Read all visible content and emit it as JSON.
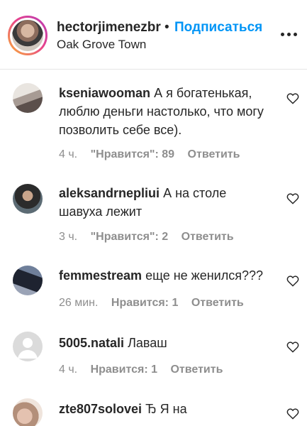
{
  "header": {
    "username": "hectorjimenezbr",
    "separator": "•",
    "follow_label": "Подписаться",
    "location": "Oak Grove Town"
  },
  "comments": [
    {
      "username": "kseniawooman",
      "text": "А я богатенькая, люблю деньги настолько, что могу позволить себе все).",
      "time": "4 ч.",
      "likes": "\"Нравится\": 89",
      "reply": "Ответить"
    },
    {
      "username": "aleksandrnepliui",
      "text": "А на столе шавуха лежит",
      "time": "3 ч.",
      "likes": "\"Нравится\": 2",
      "reply": "Ответить"
    },
    {
      "username": "femmestream",
      "text": "еще не женился???",
      "time": "26 мин.",
      "likes": "Нравится: 1",
      "reply": "Ответить"
    },
    {
      "username": "5005.natali",
      "text": "Лаваш",
      "time": "4 ч.",
      "likes": "Нравится: 1",
      "reply": "Ответить"
    },
    {
      "username": "zte807solovei",
      "text": "Ђ Я на",
      "time": "",
      "likes": "",
      "reply": ""
    }
  ],
  "icons": {
    "more": "more-options-icon",
    "like": "heart-outline-icon",
    "default_avatar": "default-avatar-icon"
  }
}
